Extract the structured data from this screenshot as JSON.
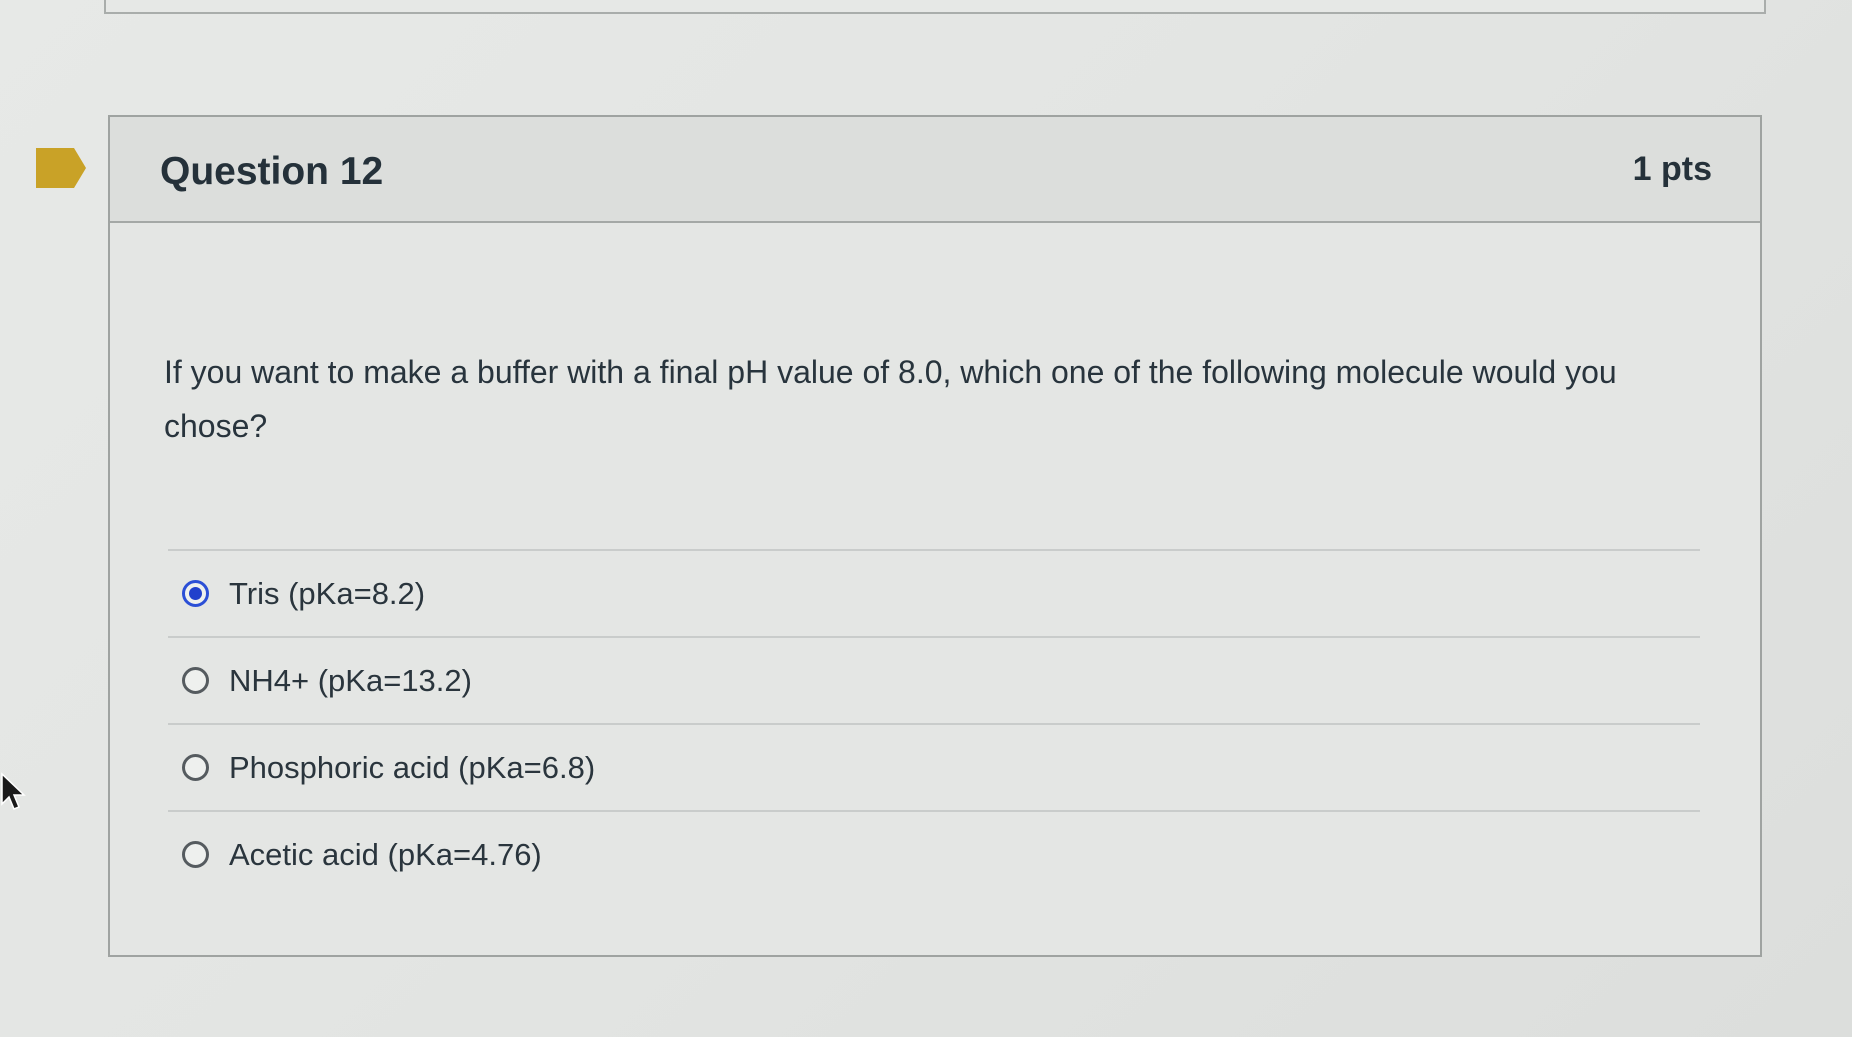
{
  "question": {
    "title": "Question 12",
    "points": "1 pts",
    "text": "If you want to make a buffer with a final pH value of 8.0, which one of the following molecule would you chose?",
    "options": [
      {
        "label": "Tris (pKa=8.2)",
        "selected": true
      },
      {
        "label": "NH4+ (pKa=13.2)",
        "selected": false
      },
      {
        "label": "Phosphoric acid (pKa=6.8)",
        "selected": false
      },
      {
        "label": "Acetic acid (pKa=4.76)",
        "selected": false
      }
    ]
  },
  "colors": {
    "flag": "#c9a227",
    "radio_selected": "#2140cc"
  },
  "icons": {
    "flag": "flag-icon",
    "cursor": "cursor-arrow-icon"
  }
}
